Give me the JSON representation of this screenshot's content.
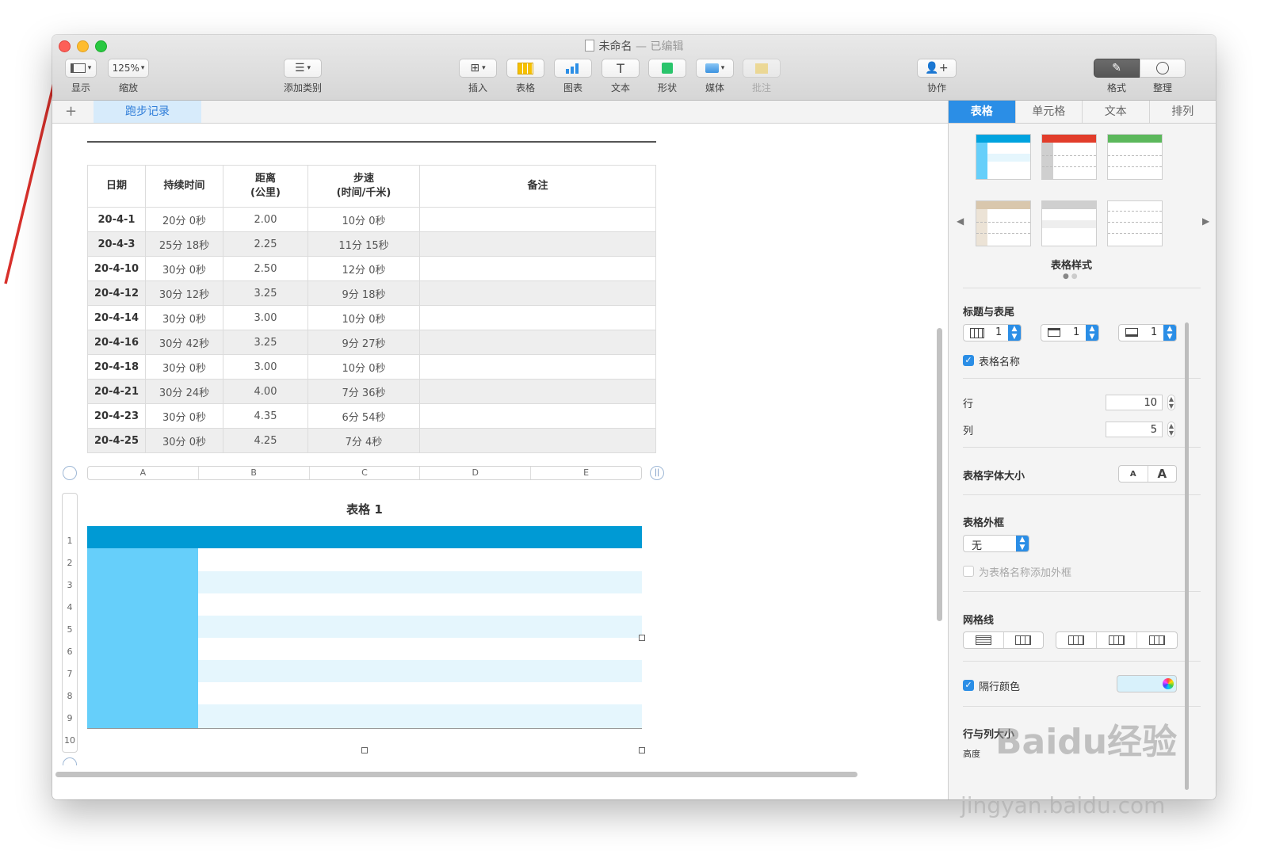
{
  "window": {
    "title": "未命名",
    "edited_suffix": "— 已编辑"
  },
  "toolbar": {
    "view": "显示",
    "zoom_value": "125%",
    "zoom": "缩放",
    "add_category": "添加类别",
    "insert": "插入",
    "table": "表格",
    "chart": "图表",
    "text": "文本",
    "shape": "形状",
    "media": "媒体",
    "comment": "批注",
    "collaborate": "协作",
    "format": "格式",
    "organize": "整理"
  },
  "sheet": {
    "add": "+",
    "tab": "跑步记录"
  },
  "run_table": {
    "headers": [
      "日期",
      "持续时间",
      "距离\n(公里)",
      "步速\n(时间/千米)",
      "备注"
    ],
    "rows": [
      [
        "20-4-1",
        "20分 0秒",
        "2.00",
        "10分 0秒",
        ""
      ],
      [
        "20-4-3",
        "25分 18秒",
        "2.25",
        "11分 15秒",
        ""
      ],
      [
        "20-4-10",
        "30分 0秒",
        "2.50",
        "12分 0秒",
        ""
      ],
      [
        "20-4-12",
        "30分 12秒",
        "3.25",
        "9分 18秒",
        ""
      ],
      [
        "20-4-14",
        "30分 0秒",
        "3.00",
        "10分 0秒",
        ""
      ],
      [
        "20-4-16",
        "30分 42秒",
        "3.25",
        "9分 27秒",
        ""
      ],
      [
        "20-4-18",
        "30分 0秒",
        "3.00",
        "10分 0秒",
        ""
      ],
      [
        "20-4-21",
        "30分 24秒",
        "4.00",
        "7分 36秒",
        ""
      ],
      [
        "20-4-23",
        "30分 0秒",
        "4.35",
        "6分 54秒",
        ""
      ],
      [
        "20-4-25",
        "30分 0秒",
        "4.25",
        "7分 4秒",
        ""
      ]
    ]
  },
  "table1": {
    "title": "表格 1",
    "columns": [
      "A",
      "B",
      "C",
      "D",
      "E"
    ],
    "rows": [
      "1",
      "2",
      "3",
      "4",
      "5",
      "6",
      "7",
      "8",
      "9",
      "10"
    ],
    "header_color": "#009ad4",
    "column_color": "#66cffa",
    "band_color": "#e5f6fd"
  },
  "inspector": {
    "tabs": [
      "表格",
      "单元格",
      "文本",
      "排列"
    ],
    "styles_label": "表格样式",
    "headers_footers": "标题与表尾",
    "header_rows": "1",
    "header_cols": "1",
    "footer_rows": "1",
    "table_name": "表格名称",
    "rows_label": "行",
    "rows_value": "10",
    "cols_label": "列",
    "cols_value": "5",
    "font_size": "表格字体大小",
    "font_small": "A",
    "font_large": "A",
    "outline": "表格外框",
    "outline_value": "无",
    "outline_name": "为表格名称添加外框",
    "gridlines": "网格线",
    "alternating": "隔行颜色",
    "alternating_color": "#d8f1fb",
    "row_col_size": "行与列大小",
    "height_label": "高度"
  },
  "watermark": {
    "brand": "Baidu经验",
    "url": "jingyan.baidu.com"
  }
}
